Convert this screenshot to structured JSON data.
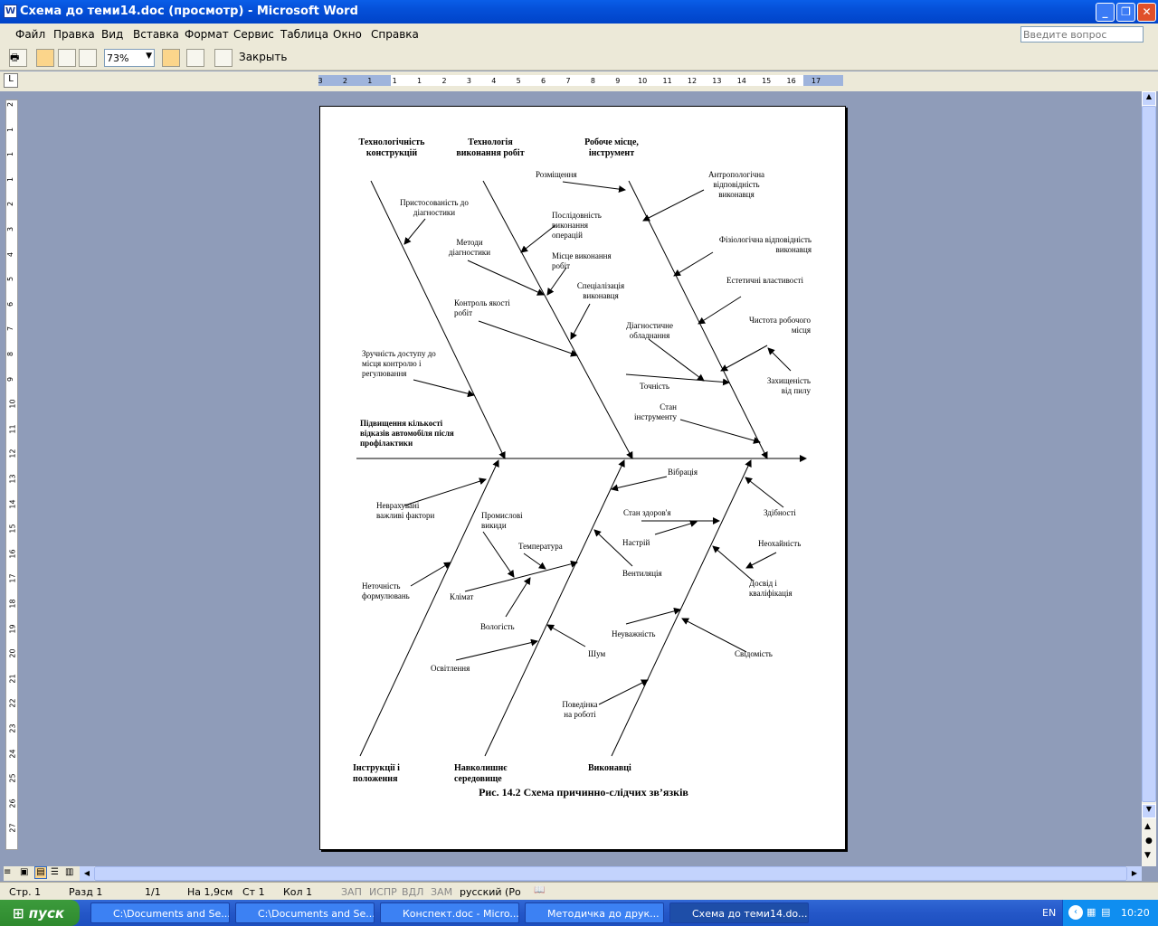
{
  "window": {
    "title": "Схема до теми14.doc (просмотр) - Microsoft Word"
  },
  "menu": [
    "Файл",
    "Правка",
    "Вид",
    "Вставка",
    "Формат",
    "Сервис",
    "Таблица",
    "Окно",
    "Справка"
  ],
  "help": {
    "placeholder": "Введите вопрос"
  },
  "toolbar": {
    "zoom": "73%",
    "close_label": "Закрыть"
  },
  "ruler": {
    "labels": [
      "3",
      "2",
      "1",
      "1",
      "1",
      "2",
      "3",
      "4",
      "5",
      "6",
      "7",
      "8",
      "9",
      "10",
      "11",
      "12",
      "13",
      "14",
      "15",
      "16",
      "17"
    ]
  },
  "diagram": {
    "top_heads": [
      "Технологічність конструкцій",
      "Технологія виконання робіт",
      "Робоче місце, інструмент"
    ],
    "effect": "Підвищення кількості відказів автомобіля після профілактики",
    "bottom_heads": [
      "Інструкції і положення",
      "Навколишнє середовище",
      "Виконавці"
    ],
    "causes": [
      "Пристосованість до діагностики",
      "Методи діагностики",
      "Контроль якості робіт",
      "Зручність доступу до місця контролю і регулювання",
      "Послідовність виконання операцій",
      "Місце виконання робіт",
      "Спеціалізація виконавця",
      "Розміщення",
      "Антропологічна відповідність виконавця",
      "Фізіологічна відповідність виконавця",
      "Естетичні властивості",
      "Діагностичне обладнання",
      "Чистота робочого місця",
      "Точність",
      "Захищеність від пилу",
      "Стан інструменту",
      "Неврахувані важливі фактори",
      "Неточність формулювань",
      "Промислові викиди",
      "Температура",
      "Клімат",
      "Вологість",
      "Освітлення",
      "Вібрація",
      "Стан здоров'я",
      "Настрій",
      "Вентиляція",
      "Шум",
      "Здібності",
      "Неохайність",
      "Досвід і кваліфікація",
      "Неуважність",
      "Свідомість",
      "Поведінка на роботі"
    ],
    "caption": "Рис. 14.2 Схема причинно-слідчих зв’язків"
  },
  "status": {
    "page": "Стр. 1",
    "section": "Разд 1",
    "pages": "1/1",
    "at": "На 1,9см",
    "line": "Ст 1",
    "col": "Кол 1",
    "rec": "ЗАП",
    "trk": "ИСПР",
    "ext": "ВДЛ",
    "ovr": "ЗАМ",
    "lang": "русский (Ро"
  },
  "taskbar": {
    "start": "пуск",
    "items": [
      "C:\\Documents and Se...",
      "C:\\Documents and Se...",
      "Конспект.doc - Micro...",
      "Методичка до друк...",
      "Схема до теми14.do..."
    ],
    "lang": "EN",
    "time": "10:20"
  }
}
